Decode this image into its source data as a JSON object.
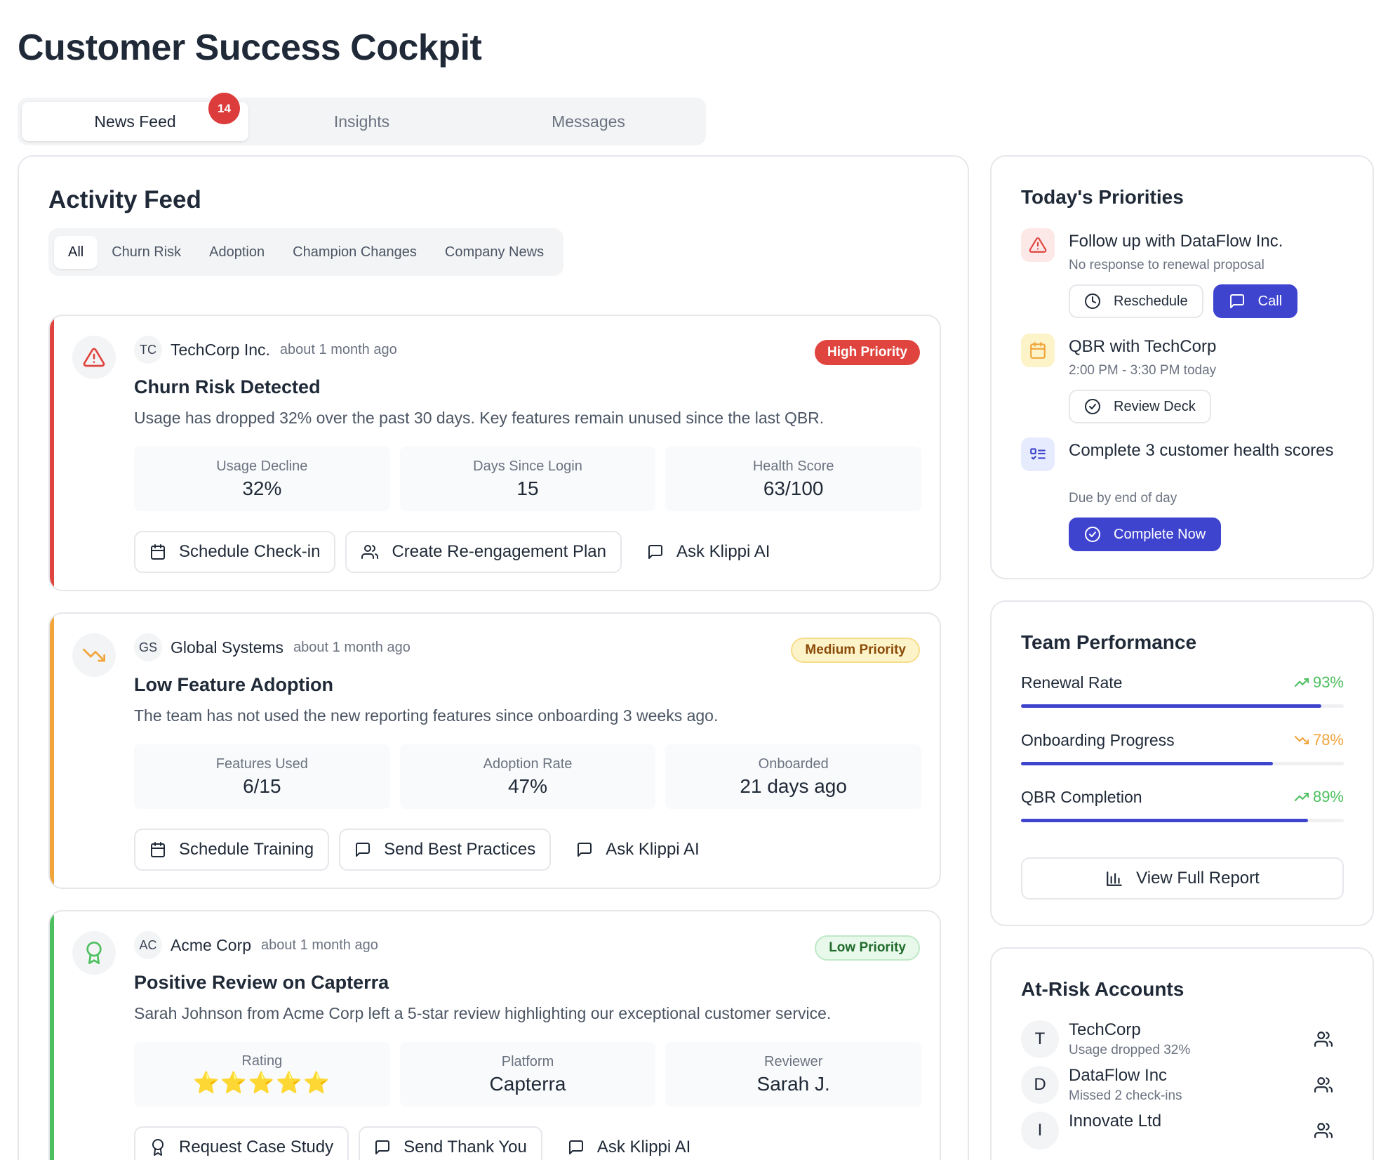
{
  "page": {
    "title": "Customer Success Cockpit"
  },
  "tabs": [
    {
      "label": "News Feed",
      "badge": "14"
    },
    {
      "label": "Insights"
    },
    {
      "label": "Messages"
    }
  ],
  "feed": {
    "title": "Activity Feed",
    "filters": [
      "All",
      "Churn Risk",
      "Adoption",
      "Champion Changes",
      "Company News"
    ],
    "cards": [
      {
        "accent": "#e0443e",
        "icon": "alert-triangle-icon",
        "initials": "TC",
        "company": "TechCorp Inc.",
        "time": "about 1 month ago",
        "priority": "High Priority",
        "title": "Churn Risk Detected",
        "description": "Usage has dropped 32% over the past 30 days. Key features remain unused since the last QBR.",
        "metrics": [
          {
            "label": "Usage Decline",
            "value": "32%"
          },
          {
            "label": "Days Since Login",
            "value": "15"
          },
          {
            "label": "Health Score",
            "value": "63/100"
          }
        ],
        "actions": [
          "Schedule Check-in",
          "Create Re-engagement Plan",
          "Ask Klippi AI"
        ]
      },
      {
        "accent": "#f0a43a",
        "icon": "trending-down-icon",
        "initials": "GS",
        "company": "Global Systems",
        "time": "about 1 month ago",
        "priority": "Medium Priority",
        "title": "Low Feature Adoption",
        "description": "The team has not used the new reporting features since onboarding 3 weeks ago.",
        "metrics": [
          {
            "label": "Features Used",
            "value": "6/15"
          },
          {
            "label": "Adoption Rate",
            "value": "47%"
          },
          {
            "label": "Onboarded",
            "value": "21 days ago"
          }
        ],
        "actions": [
          "Schedule Training",
          "Send Best Practices",
          "Ask Klippi AI"
        ]
      },
      {
        "accent": "#4cbf5e",
        "icon": "award-icon",
        "initials": "AC",
        "company": "Acme Corp",
        "time": "about 1 month ago",
        "priority": "Low Priority",
        "title": "Positive Review on Capterra",
        "description": "Sarah Johnson from Acme Corp left a 5-star review highlighting our exceptional customer service.",
        "metrics": [
          {
            "label": "Rating",
            "value": "⭐⭐⭐⭐⭐"
          },
          {
            "label": "Platform",
            "value": "Capterra"
          },
          {
            "label": "Reviewer",
            "value": "Sarah J."
          }
        ],
        "actions": [
          "Request Case Study",
          "Send Thank You",
          "Ask Klippi AI"
        ]
      }
    ]
  },
  "priorities": {
    "title": "Today's Priorities",
    "items": [
      {
        "title": "Follow up with DataFlow Inc.",
        "subtitle": "No response to renewal proposal",
        "buttons": [
          "Reschedule",
          "Call"
        ]
      },
      {
        "title": "QBR with TechCorp",
        "subtitle": "2:00 PM - 3:30 PM today",
        "buttons": [
          "Review Deck"
        ]
      },
      {
        "title": "Complete 3 customer health scores",
        "subtitle": "Due by end of day",
        "buttons": [
          "Complete Now"
        ]
      }
    ]
  },
  "performance": {
    "title": "Team Performance",
    "metrics": [
      {
        "label": "Renewal Rate",
        "value": "93%",
        "fraction": 0.93,
        "trend": "up"
      },
      {
        "label": "Onboarding Progress",
        "value": "78%",
        "fraction": 0.78,
        "trend": "down"
      },
      {
        "label": "QBR Completion",
        "value": "89%",
        "fraction": 0.89,
        "trend": "up"
      }
    ],
    "report_button": "View Full Report"
  },
  "at_risk": {
    "title": "At-Risk Accounts",
    "accounts": [
      {
        "initial": "T",
        "name": "TechCorp",
        "detail": "Usage dropped 32%"
      },
      {
        "initial": "D",
        "name": "DataFlow Inc",
        "detail": "Missed 2 check-ins"
      },
      {
        "initial": "I",
        "name": "Innovate Ltd",
        "detail": ""
      }
    ]
  },
  "colors": {
    "primary": "#3f44cf",
    "high": "#e0443e",
    "medium": "#f0a43a",
    "low": "#4cbf5e",
    "trend_up": "#4cbf5e",
    "trend_down": "#f0a43a"
  }
}
